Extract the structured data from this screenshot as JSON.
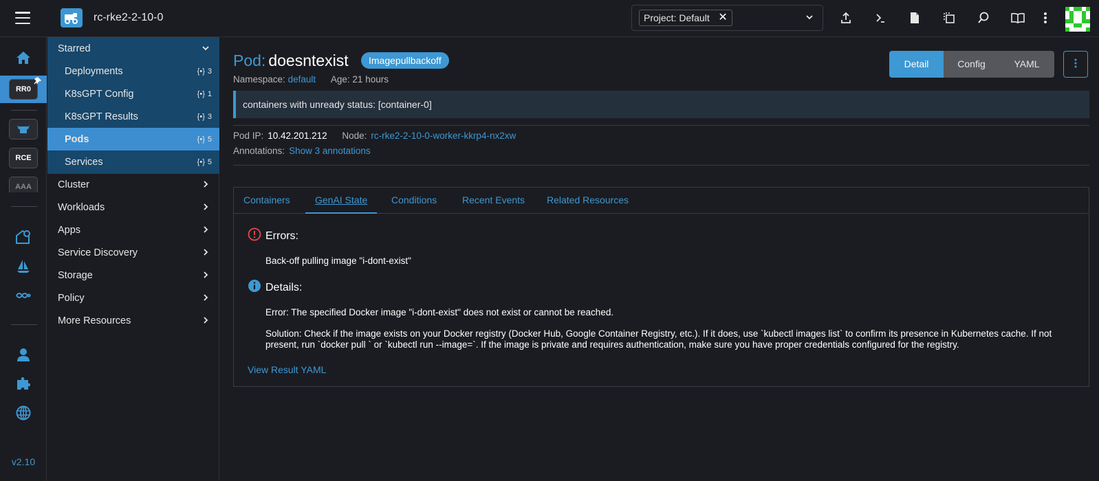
{
  "header": {
    "cluster_name": "rc-rke2-2-10-0",
    "project_select": {
      "value": "Project: Default"
    }
  },
  "rail": {
    "clusters": [
      {
        "label": "RR0"
      },
      {
        "label": "RCE"
      },
      {
        "label": "AAA"
      }
    ],
    "version": "v2.10"
  },
  "sidenav": {
    "starred_label": "Starred",
    "starred_items": [
      {
        "label": "Deployments",
        "count": "3"
      },
      {
        "label": "K8sGPT Config",
        "count": "1"
      },
      {
        "label": "K8sGPT Results",
        "count": "3"
      },
      {
        "label": "Pods",
        "count": "5"
      },
      {
        "label": "Services",
        "count": "5"
      }
    ],
    "groups": [
      {
        "label": "Cluster"
      },
      {
        "label": "Workloads"
      },
      {
        "label": "Apps"
      },
      {
        "label": "Service Discovery"
      },
      {
        "label": "Storage"
      },
      {
        "label": "Policy"
      },
      {
        "label": "More Resources"
      }
    ]
  },
  "pod": {
    "kind_label": "Pod:",
    "name": "doesntexist",
    "status": "Imagepullbackoff",
    "namespace_label": "Namespace:",
    "namespace": "default",
    "age_label": "Age:",
    "age": "21 hours",
    "banner": "containers with unready status: [container-0]",
    "ip_label": "Pod IP:",
    "ip": "10.42.201.212",
    "node_label": "Node:",
    "node": "rc-rke2-2-10-0-worker-kkrp4-nx2xw",
    "annotations_label": "Annotations:",
    "annotations_link": "Show 3 annotations"
  },
  "view_modes": [
    "Detail",
    "Config",
    "YAML"
  ],
  "tabs": [
    "Containers",
    "GenAI State",
    "Conditions",
    "Recent Events",
    "Related Resources"
  ],
  "genai": {
    "errors_title": "Errors:",
    "errors_text": "Back-off pulling image \"i-dont-exist\"",
    "details_title": "Details:",
    "details_error": "Error: The specified Docker image \"i-dont-exist\" does not exist or cannot be reached.",
    "details_solution": "Solution: Check if the image exists on your Docker registry (Docker Hub, Google Container Registry, etc.). If it does, use `kubectl images list` to confirm its presence in Kubernetes cache. If not present, run `docker pull ` or `kubectl run --image=`. If the image is private and requires authentication, make sure you have proper credentials configured for the registry.",
    "view_yaml": "View Result YAML"
  },
  "colors": {
    "accent": "#3d98d3",
    "error": "#e5484d",
    "starred_bg": "#17476b",
    "active_bg": "#3d8ed0"
  }
}
